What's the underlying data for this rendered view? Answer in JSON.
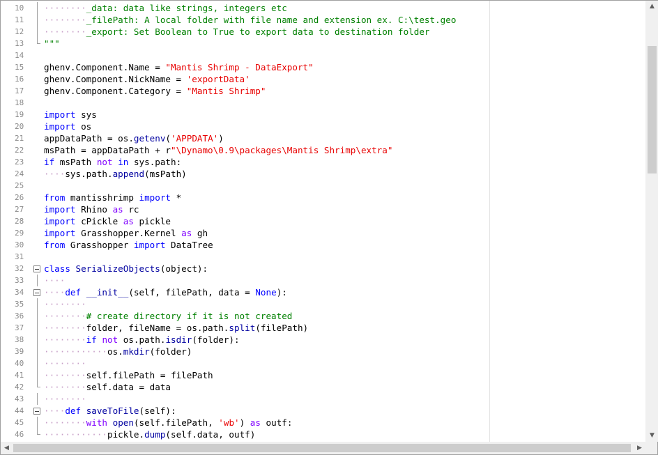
{
  "editor": {
    "lines": [
      {
        "n": "10",
        "fold": "line",
        "segs": [
          {
            "c": "dots",
            "t": "········"
          },
          {
            "c": "cm",
            "t": "_data: data like strings, integers etc"
          }
        ]
      },
      {
        "n": "11",
        "fold": "line",
        "segs": [
          {
            "c": "dots",
            "t": "········"
          },
          {
            "c": "cm",
            "t": "_filePath: A local folder with file name and extension ex. C:\\test.geo"
          }
        ]
      },
      {
        "n": "12",
        "fold": "line",
        "segs": [
          {
            "c": "dots",
            "t": "········"
          },
          {
            "c": "cm",
            "t": "_export: Set Boolean to True to export data to destination folder"
          }
        ]
      },
      {
        "n": "13",
        "fold": "end",
        "segs": [
          {
            "c": "cm",
            "t": "\"\"\""
          }
        ]
      },
      {
        "n": "14",
        "fold": "",
        "segs": []
      },
      {
        "n": "15",
        "fold": "",
        "segs": [
          {
            "c": "",
            "t": "ghenv.Component.Name = "
          },
          {
            "c": "str",
            "t": "\"Mantis Shrimp - DataExport\""
          }
        ]
      },
      {
        "n": "16",
        "fold": "",
        "segs": [
          {
            "c": "",
            "t": "ghenv.Component.NickName = "
          },
          {
            "c": "str",
            "t": "'exportData'"
          }
        ]
      },
      {
        "n": "17",
        "fold": "",
        "segs": [
          {
            "c": "",
            "t": "ghenv.Component.Category = "
          },
          {
            "c": "str",
            "t": "\"Mantis Shrimp\""
          }
        ]
      },
      {
        "n": "18",
        "fold": "",
        "segs": []
      },
      {
        "n": "19",
        "fold": "",
        "segs": [
          {
            "c": "kw",
            "t": "import"
          },
          {
            "c": "",
            "t": " sys"
          }
        ]
      },
      {
        "n": "20",
        "fold": "",
        "segs": [
          {
            "c": "kw",
            "t": "import"
          },
          {
            "c": "",
            "t": " os"
          }
        ]
      },
      {
        "n": "21",
        "fold": "",
        "segs": [
          {
            "c": "",
            "t": "appDataPath = os."
          },
          {
            "c": "fn",
            "t": "getenv"
          },
          {
            "c": "",
            "t": "("
          },
          {
            "c": "str",
            "t": "'APPDATA'"
          },
          {
            "c": "",
            "t": ")"
          }
        ]
      },
      {
        "n": "22",
        "fold": "",
        "segs": [
          {
            "c": "",
            "t": "msPath = appDataPath + r"
          },
          {
            "c": "str",
            "t": "\"\\Dynamo\\0.9\\packages\\Mantis Shrimp\\extra\""
          }
        ]
      },
      {
        "n": "23",
        "fold": "",
        "segs": [
          {
            "c": "kw",
            "t": "if"
          },
          {
            "c": "",
            "t": " msPath "
          },
          {
            "c": "kw2",
            "t": "not"
          },
          {
            "c": "",
            "t": " "
          },
          {
            "c": "kw",
            "t": "in"
          },
          {
            "c": "",
            "t": " sys.path:"
          }
        ]
      },
      {
        "n": "24",
        "fold": "",
        "segs": [
          {
            "c": "dots",
            "t": "····"
          },
          {
            "c": "",
            "t": "sys.path."
          },
          {
            "c": "fn",
            "t": "append"
          },
          {
            "c": "",
            "t": "(msPath)"
          }
        ]
      },
      {
        "n": "25",
        "fold": "",
        "segs": []
      },
      {
        "n": "26",
        "fold": "",
        "segs": [
          {
            "c": "kw",
            "t": "from"
          },
          {
            "c": "",
            "t": " mantisshrimp "
          },
          {
            "c": "kw",
            "t": "import"
          },
          {
            "c": "",
            "t": " *"
          }
        ]
      },
      {
        "n": "27",
        "fold": "",
        "segs": [
          {
            "c": "kw",
            "t": "import"
          },
          {
            "c": "",
            "t": " Rhino "
          },
          {
            "c": "kw2",
            "t": "as"
          },
          {
            "c": "",
            "t": " rc"
          }
        ]
      },
      {
        "n": "28",
        "fold": "",
        "segs": [
          {
            "c": "kw",
            "t": "import"
          },
          {
            "c": "",
            "t": " cPickle "
          },
          {
            "c": "kw2",
            "t": "as"
          },
          {
            "c": "",
            "t": " pickle"
          }
        ]
      },
      {
        "n": "29",
        "fold": "",
        "segs": [
          {
            "c": "kw",
            "t": "import"
          },
          {
            "c": "",
            "t": " Grasshopper.Kernel "
          },
          {
            "c": "kw2",
            "t": "as"
          },
          {
            "c": "",
            "t": " gh"
          }
        ]
      },
      {
        "n": "30",
        "fold": "",
        "segs": [
          {
            "c": "kw",
            "t": "from"
          },
          {
            "c": "",
            "t": " Grasshopper "
          },
          {
            "c": "kw",
            "t": "import"
          },
          {
            "c": "",
            "t": " DataTree"
          }
        ]
      },
      {
        "n": "31",
        "fold": "",
        "segs": []
      },
      {
        "n": "32",
        "fold": "box",
        "segs": [
          {
            "c": "kw",
            "t": "class"
          },
          {
            "c": "",
            "t": " "
          },
          {
            "c": "fn",
            "t": "SerializeObjects"
          },
          {
            "c": "",
            "t": "(object):"
          }
        ]
      },
      {
        "n": "33",
        "fold": "line",
        "segs": [
          {
            "c": "dots",
            "t": "····"
          }
        ]
      },
      {
        "n": "34",
        "fold": "box",
        "segs": [
          {
            "c": "dots",
            "t": "····"
          },
          {
            "c": "kw",
            "t": "def"
          },
          {
            "c": "",
            "t": " "
          },
          {
            "c": "fn",
            "t": "__init__"
          },
          {
            "c": "",
            "t": "(self, filePath, data = "
          },
          {
            "c": "kw",
            "t": "None"
          },
          {
            "c": "",
            "t": "):"
          }
        ]
      },
      {
        "n": "35",
        "fold": "line",
        "segs": [
          {
            "c": "dots",
            "t": "········"
          }
        ]
      },
      {
        "n": "36",
        "fold": "line",
        "segs": [
          {
            "c": "dots",
            "t": "········"
          },
          {
            "c": "cm",
            "t": "# create directory if it is not created"
          }
        ]
      },
      {
        "n": "37",
        "fold": "line",
        "segs": [
          {
            "c": "dots",
            "t": "········"
          },
          {
            "c": "",
            "t": "folder, fileName = os.path."
          },
          {
            "c": "fn",
            "t": "split"
          },
          {
            "c": "",
            "t": "(filePath)"
          }
        ]
      },
      {
        "n": "38",
        "fold": "line",
        "segs": [
          {
            "c": "dots",
            "t": "········"
          },
          {
            "c": "kw",
            "t": "if"
          },
          {
            "c": "",
            "t": " "
          },
          {
            "c": "kw2",
            "t": "not"
          },
          {
            "c": "",
            "t": " os.path."
          },
          {
            "c": "fn",
            "t": "isdir"
          },
          {
            "c": "",
            "t": "(folder):"
          }
        ]
      },
      {
        "n": "39",
        "fold": "line",
        "segs": [
          {
            "c": "dots",
            "t": "············"
          },
          {
            "c": "",
            "t": "os."
          },
          {
            "c": "fn",
            "t": "mkdir"
          },
          {
            "c": "",
            "t": "(folder)"
          }
        ]
      },
      {
        "n": "40",
        "fold": "line",
        "segs": [
          {
            "c": "dots",
            "t": "········"
          }
        ]
      },
      {
        "n": "41",
        "fold": "line",
        "segs": [
          {
            "c": "dots",
            "t": "········"
          },
          {
            "c": "",
            "t": "self.filePath = filePath"
          }
        ]
      },
      {
        "n": "42",
        "fold": "end",
        "segs": [
          {
            "c": "dots",
            "t": "········"
          },
          {
            "c": "",
            "t": "self.data = data"
          }
        ]
      },
      {
        "n": "43",
        "fold": "line",
        "segs": [
          {
            "c": "dots",
            "t": "········"
          }
        ]
      },
      {
        "n": "44",
        "fold": "box",
        "segs": [
          {
            "c": "dots",
            "t": "····"
          },
          {
            "c": "kw",
            "t": "def"
          },
          {
            "c": "",
            "t": " "
          },
          {
            "c": "fn",
            "t": "saveToFile"
          },
          {
            "c": "",
            "t": "(self):"
          }
        ]
      },
      {
        "n": "45",
        "fold": "line",
        "segs": [
          {
            "c": "dots",
            "t": "········"
          },
          {
            "c": "kw2",
            "t": "with"
          },
          {
            "c": "",
            "t": " "
          },
          {
            "c": "fn",
            "t": "open"
          },
          {
            "c": "",
            "t": "(self.filePath, "
          },
          {
            "c": "str",
            "t": "'wb'"
          },
          {
            "c": "",
            "t": ") "
          },
          {
            "c": "kw2",
            "t": "as"
          },
          {
            "c": "",
            "t": " outf:"
          }
        ]
      },
      {
        "n": "46",
        "fold": "end",
        "segs": [
          {
            "c": "dots",
            "t": "············"
          },
          {
            "c": "",
            "t": "pickle."
          },
          {
            "c": "fn",
            "t": "dump"
          },
          {
            "c": "",
            "t": "(self.data, outf)"
          }
        ]
      }
    ]
  },
  "scrollbars": {
    "up_arrow": "▲",
    "down_arrow": "▼",
    "left_arrow": "◀",
    "right_arrow": "▶"
  }
}
